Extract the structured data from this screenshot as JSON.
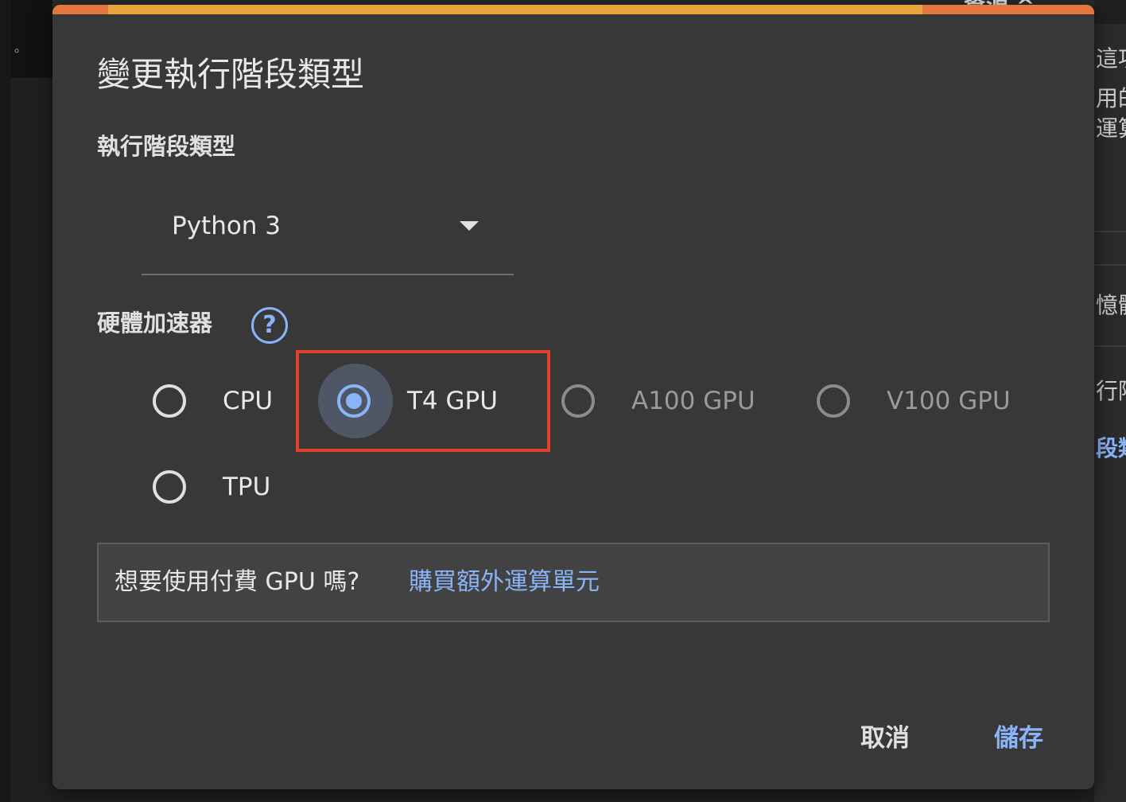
{
  "background": {
    "header_title": "資源 ^",
    "side_text": [
      "這項",
      "用的",
      "運算",
      "憶體",
      "行階",
      "段類"
    ],
    "left_marker": "。"
  },
  "dialog": {
    "title": "變更執行階段類型",
    "runtime_section_label": "執行階段類型",
    "runtime_selected": "Python 3",
    "accelerator_section_label": "硬體加速器",
    "help_symbol": "?",
    "accelerator_options": [
      {
        "label": "CPU",
        "selected": false,
        "disabled": false
      },
      {
        "label": "T4 GPU",
        "selected": true,
        "disabled": false
      },
      {
        "label": "A100 GPU",
        "selected": false,
        "disabled": true
      },
      {
        "label": "V100 GPU",
        "selected": false,
        "disabled": true
      },
      {
        "label": "TPU",
        "selected": false,
        "disabled": false
      }
    ],
    "promo_text": "想要使用付費 GPU 嗎?",
    "promo_link": "購買額外運算單元",
    "cancel_label": "取消",
    "save_label": "儲存"
  },
  "colors": {
    "dialog_bg": "#383838",
    "accent": "#8ab4f8",
    "highlight_border": "#e0402a",
    "top_progress": "#e8a33d"
  }
}
